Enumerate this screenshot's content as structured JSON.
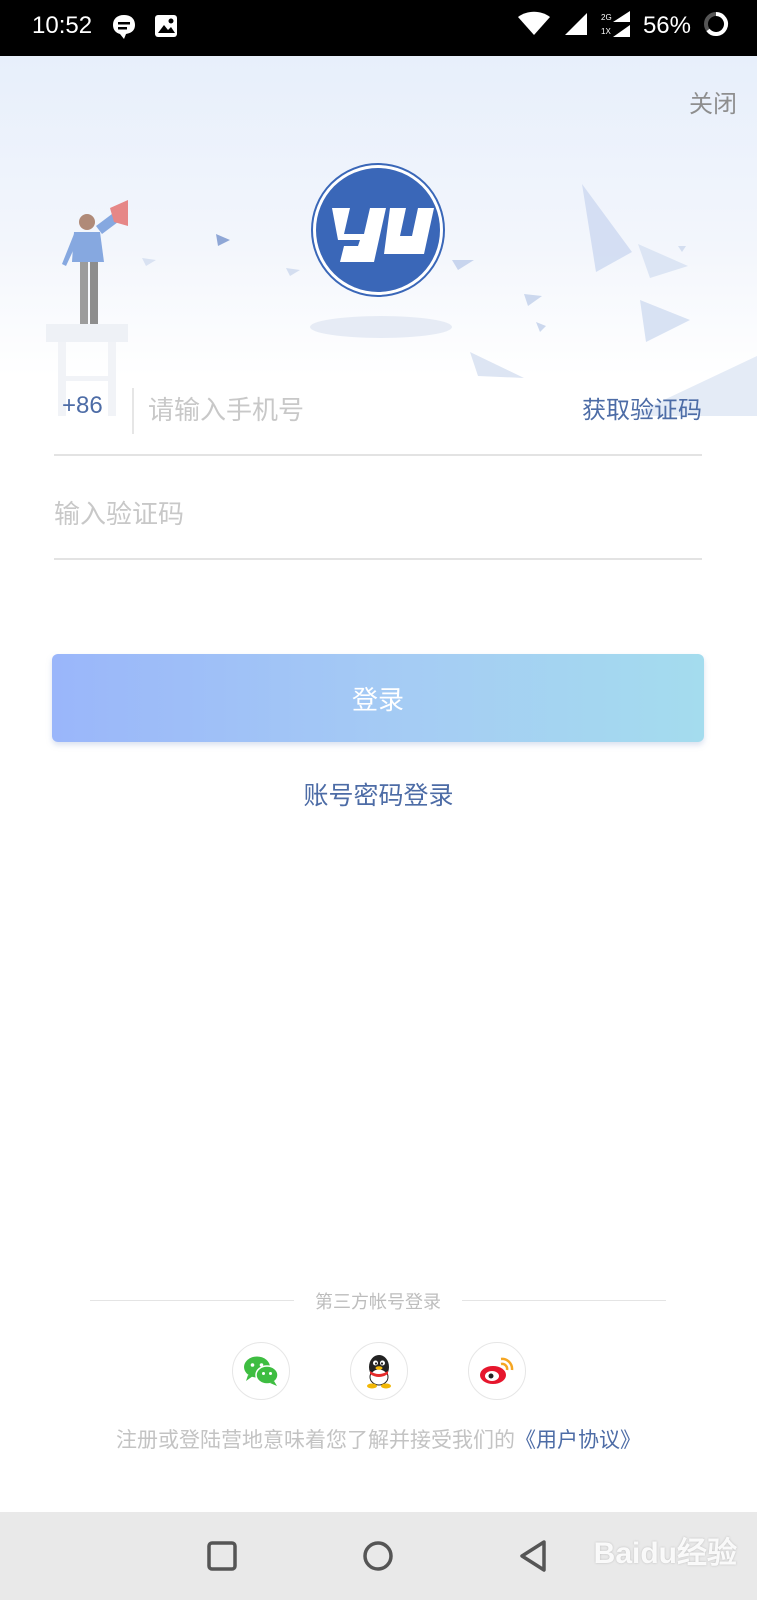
{
  "status_bar": {
    "time": "10:52",
    "network_label": "2G 1X",
    "battery": "56%",
    "icons": [
      "chat-bubble-icon",
      "image-icon",
      "wifi-icon",
      "signal-icon",
      "battery-ring-icon"
    ]
  },
  "header": {
    "close_label": "关闭",
    "logo_text": "yu",
    "accent_color": "#3a67b8"
  },
  "form": {
    "country_code": "+86",
    "phone_placeholder": "请输入手机号",
    "get_code_label": "获取验证码",
    "code_placeholder": "输入验证码",
    "login_label": "登录",
    "password_login_label": "账号密码登录"
  },
  "third_party": {
    "title": "第三方帐号登录",
    "providers": [
      "wechat-icon",
      "qq-icon",
      "weibo-icon"
    ]
  },
  "agreement": {
    "text": "注册或登陆营地意味着您了解并接受我们的",
    "link": "《用户协议》"
  },
  "nav_bar": {
    "buttons": [
      "recent-apps-icon",
      "home-icon",
      "back-icon"
    ]
  },
  "watermark": "Baidu经验"
}
